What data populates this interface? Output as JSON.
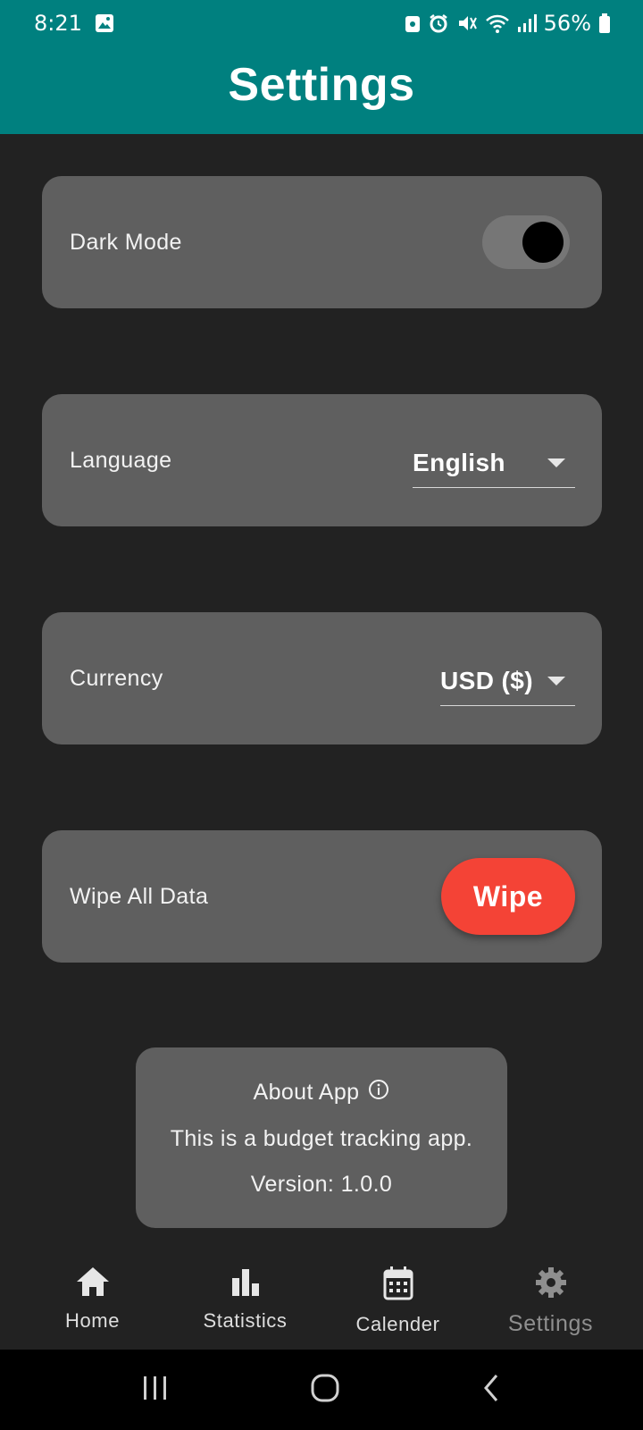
{
  "status_bar": {
    "time": "8:21",
    "battery": "56%",
    "icons": [
      "gallery-icon",
      "lock-icon",
      "alarm-icon",
      "mute-icon",
      "wifi-icon",
      "signal-icon",
      "battery-icon"
    ]
  },
  "header": {
    "title": "Settings"
  },
  "settings": {
    "dark_mode": {
      "label": "Dark Mode",
      "enabled": true
    },
    "language": {
      "label": "Language",
      "value": "English"
    },
    "currency": {
      "label": "Currency",
      "value": "USD ($)"
    },
    "wipe": {
      "label": "Wipe All Data",
      "button_label": "Wipe"
    }
  },
  "about": {
    "title": "About App",
    "description": "This is a budget tracking app.",
    "version": "Version: 1.0.0"
  },
  "bottom_nav": {
    "items": [
      {
        "label": "Home",
        "icon": "home-icon"
      },
      {
        "label": "Statistics",
        "icon": "bar-chart-icon"
      },
      {
        "label": "Calender",
        "icon": "calendar-icon"
      },
      {
        "label": "Settings",
        "icon": "gear-icon",
        "active": true
      }
    ]
  },
  "colors": {
    "header": "#00807f",
    "background": "#222222",
    "card": "#5f5f5f",
    "danger": "#f44336"
  }
}
